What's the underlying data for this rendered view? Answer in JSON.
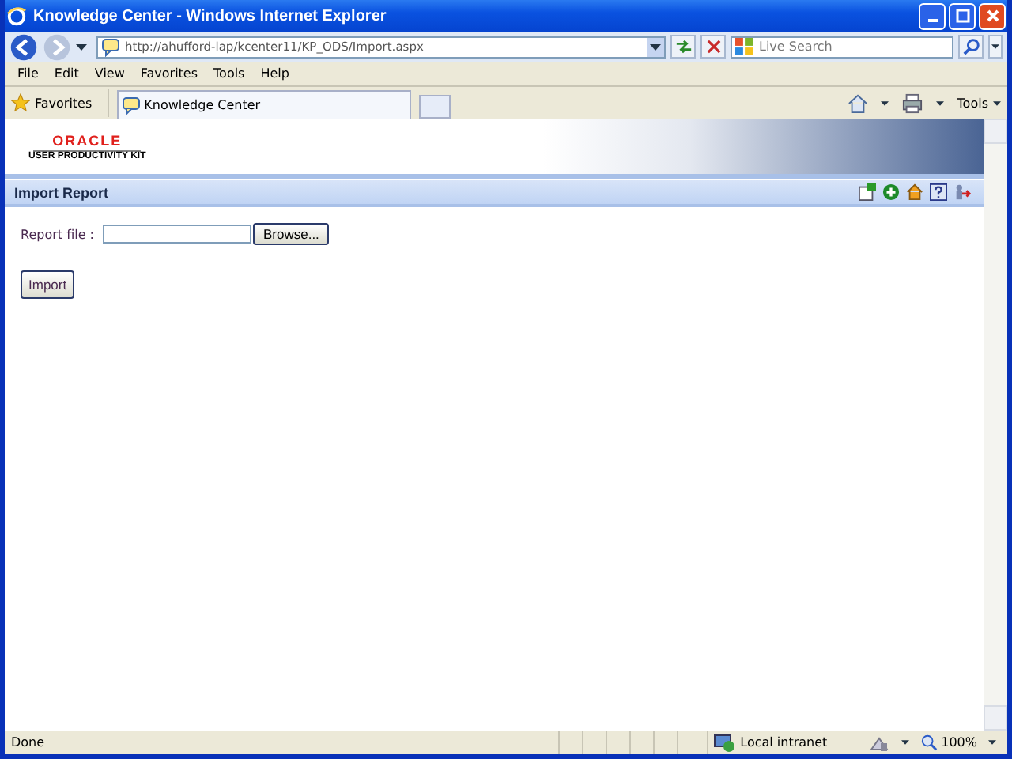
{
  "window": {
    "title": "Knowledge Center - Windows Internet Explorer"
  },
  "address": {
    "url": "http://ahufford-lap/kcenter11/KP_ODS/Import.aspx"
  },
  "search": {
    "placeholder": "Live Search"
  },
  "menu": [
    "File",
    "Edit",
    "View",
    "Favorites",
    "Tools",
    "Help"
  ],
  "favorites": {
    "label": "Favorites"
  },
  "tabs": [
    {
      "label": "Knowledge Center",
      "selected": true
    }
  ],
  "toolbar": {
    "tools_label": "Tools"
  },
  "page": {
    "logo": "ORACLE",
    "product": "USER PRODUCTIVITY KIT",
    "section_title": "Import Report",
    "file_label": "Report file :",
    "browse": "Browse...",
    "import": "Import"
  },
  "status_bar": {
    "status": "Done",
    "zone": "Local intranet",
    "zoom": "100%"
  }
}
